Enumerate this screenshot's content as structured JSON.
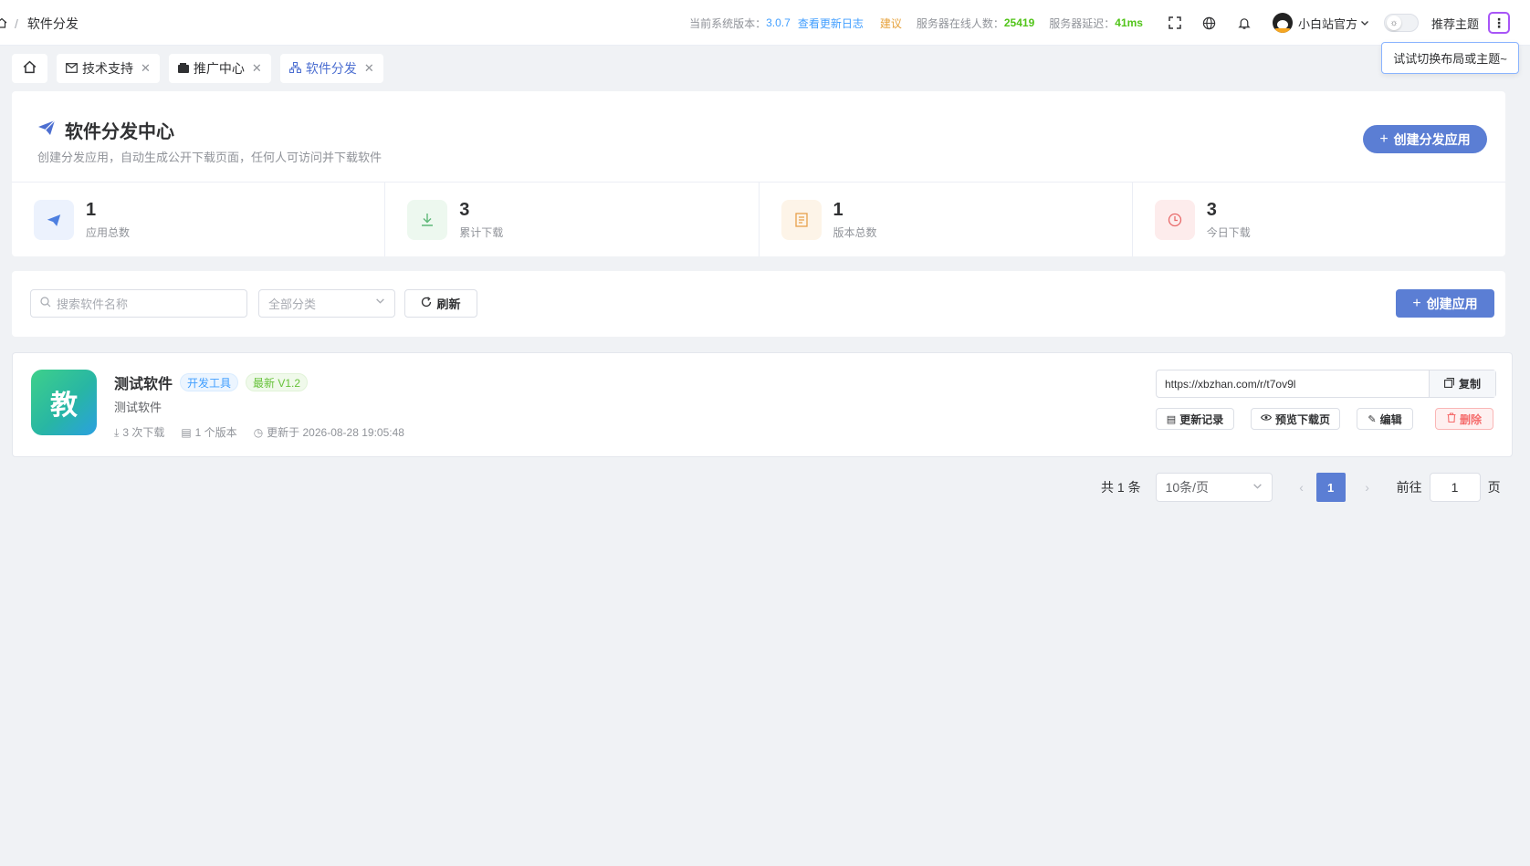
{
  "breadcrumb": {
    "current": "软件分发"
  },
  "topbar": {
    "version_label": "当前系统版本：",
    "version": "3.0.7",
    "changelog": "查看更新日志",
    "suggest": "建议",
    "online_label": "服务器在线人数：",
    "online": "25419",
    "latency_label": "服务器延迟：",
    "latency": "41ms",
    "user": "小白站官方",
    "theme": "推荐主题",
    "more": "⋮"
  },
  "tooltip": "试试切换布局或主题~",
  "tabs": [
    {
      "label": "技术支持",
      "icon": "mail-icon"
    },
    {
      "label": "推广中心",
      "icon": "wallet-icon"
    },
    {
      "label": "软件分发",
      "icon": "sitemap-icon",
      "active": true
    }
  ],
  "hero": {
    "title": "软件分发中心",
    "subtitle": "创建分发应用，自动生成公开下载页面，任何人可访问并下载软件",
    "create_button": "创建分发应用"
  },
  "stats": [
    {
      "value": "1",
      "label": "应用总数",
      "icon": "send-icon",
      "color": "#4d7fe0",
      "bg": "#ecf2fd"
    },
    {
      "value": "3",
      "label": "累计下载",
      "icon": "download-icon",
      "color": "#5fb878",
      "bg": "#edf8ef"
    },
    {
      "value": "1",
      "label": "版本总数",
      "icon": "document-icon",
      "color": "#e8a04a",
      "bg": "#fdf4e8"
    },
    {
      "value": "3",
      "label": "今日下载",
      "icon": "clock-icon",
      "color": "#e86a6a",
      "bg": "#fdecec"
    }
  ],
  "filter": {
    "search_placeholder": "搜索软件名称",
    "category_placeholder": "全部分类",
    "refresh": "刷新",
    "create": "创建应用"
  },
  "app": {
    "logo_text": "教",
    "name": "测试软件",
    "category_tag": "开发工具",
    "version_tag": "最新 V1.2",
    "desc": "测试软件",
    "downloads": "3 次下载",
    "versions": "1 个版本",
    "updated": "更新于 2026-08-28 19:05:48",
    "url": "https://xbzhan.com/r/t7ov9l",
    "copy": "复制",
    "changelog": "更新记录",
    "preview": "预览下载页",
    "edit": "编辑",
    "delete": "删除"
  },
  "pagination": {
    "total": "共 1 条",
    "page_size": "10条/页",
    "current": "1",
    "goto_label": "前往",
    "goto_value": "1",
    "goto_unit": "页"
  }
}
